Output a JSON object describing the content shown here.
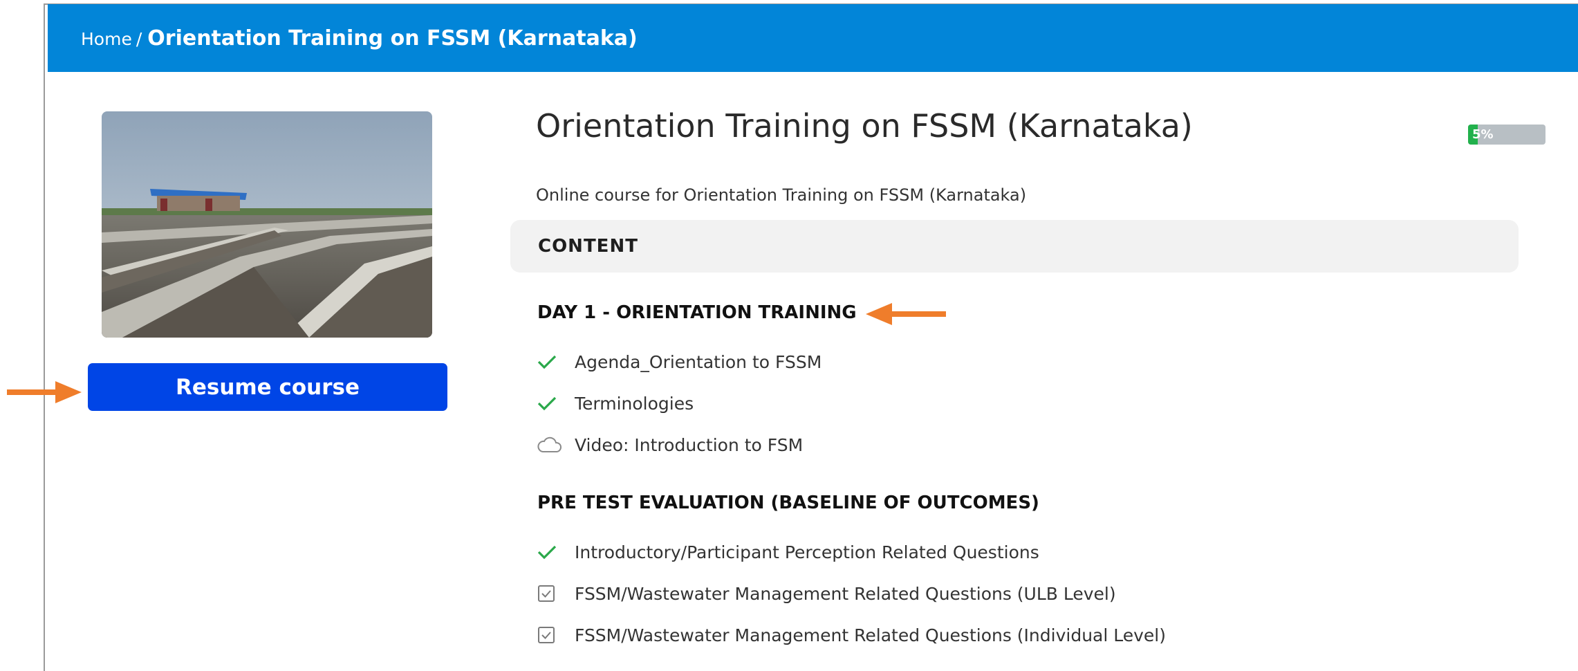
{
  "breadcrumb": {
    "home": "Home",
    "separator": "/",
    "current": "Orientation Training on FSSM (Karnataka)"
  },
  "course": {
    "title": "Orientation Training on FSSM (Karnataka)",
    "description": "Online course for Orientation Training on FSSM (Karnataka)",
    "progress": {
      "value": 0.05,
      "label": "5%"
    },
    "resume_label": "Resume course",
    "thumbnail_icon": "treatment-plant-photo"
  },
  "content": {
    "label": "CONTENT",
    "sections": [
      {
        "title": "DAY 1 - ORIENTATION TRAINING",
        "items": [
          {
            "label": "Agenda_Orientation to FSSM",
            "status_icon": "check-icon"
          },
          {
            "label": "Terminologies",
            "status_icon": "check-icon"
          },
          {
            "label": "Video: Introduction to FSM",
            "status_icon": "cloud-icon"
          }
        ]
      },
      {
        "title": "PRE TEST EVALUATION (BASELINE OF OUTCOMES)",
        "items": [
          {
            "label": "Introductory/Participant Perception Related Questions",
            "status_icon": "check-icon"
          },
          {
            "label": "FSSM/Wastewater Management Related Questions (ULB Level)",
            "status_icon": "checkbox-icon"
          },
          {
            "label": "FSSM/Wastewater Management Related Questions (Individual Level)",
            "status_icon": "checkbox-icon"
          }
        ]
      }
    ]
  },
  "colors": {
    "header": "#0285d8",
    "resume_button": "#0045e6",
    "progress_fill": "#22b14c",
    "check": "#2aa84a",
    "annotation_arrow": "#ef7d2b"
  }
}
